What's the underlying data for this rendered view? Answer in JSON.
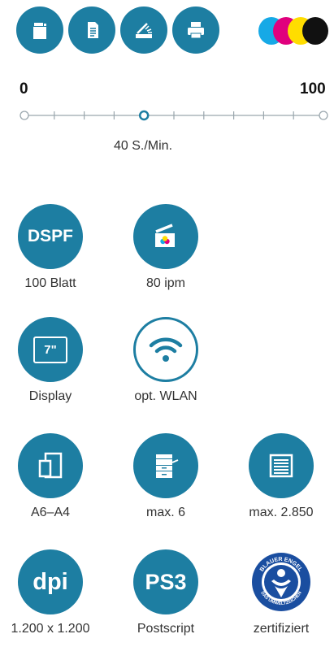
{
  "functions": [
    {
      "name": "copier",
      "icon": "copier-icon"
    },
    {
      "name": "document",
      "icon": "document-icon"
    },
    {
      "name": "scan",
      "icon": "scanner-icon"
    },
    {
      "name": "print",
      "icon": "printer-icon"
    }
  ],
  "colors": {
    "accent": "#1d7ea2",
    "cyan": "#16a9e6",
    "magenta": "#e0007d",
    "yellow": "#ffdd00",
    "black": "#111111"
  },
  "scale": {
    "min_label": "0",
    "max_label": "100",
    "value": 40,
    "speed_text": "40 S./Min."
  },
  "features": {
    "dspf": {
      "badge": "DSPF",
      "label": "100 Blatt"
    },
    "scan": {
      "label": "80 ipm"
    },
    "display": {
      "badge": "7\"",
      "label": "Display"
    },
    "wlan": {
      "label": "opt. WLAN"
    },
    "paper_size": {
      "label": "A6–A4"
    },
    "trays": {
      "label": "max. 6"
    },
    "capacity": {
      "label": "max. 2.850"
    },
    "resolution": {
      "badge": "dpi",
      "label": "1.200 x 1.200"
    },
    "postscript": {
      "badge": "PS3",
      "label": "Postscript"
    },
    "ecolabel": {
      "label": "zertifiziert",
      "seal_top": "BLAUER ENGEL",
      "seal_bottom": "DAS UMWELTZEICHEN"
    }
  }
}
